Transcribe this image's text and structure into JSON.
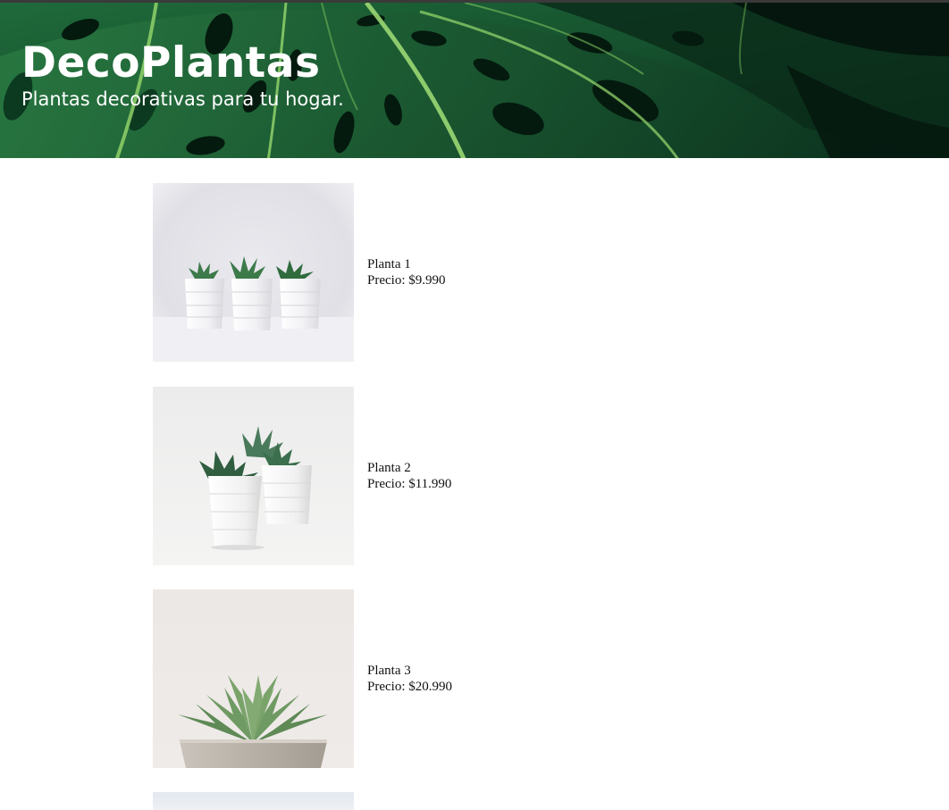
{
  "header": {
    "title": "DecoPlantas",
    "subtitle": "Plantas decorativas para tu hogar."
  },
  "products": [
    {
      "name": "Planta 1",
      "price": "Precio: $9.990",
      "image": "three-succulents-white-pots"
    },
    {
      "name": "Planta 2",
      "price": "Precio: $11.990",
      "image": "three-succulents-white-pots-angled"
    },
    {
      "name": "Planta 3",
      "price": "Precio: $20.990",
      "image": "succulent-concrete-pot"
    }
  ],
  "colors": {
    "leaf_dark": "#0b3320",
    "leaf_mid": "#1d6b3c",
    "leaf_vein": "#8fd16a"
  }
}
